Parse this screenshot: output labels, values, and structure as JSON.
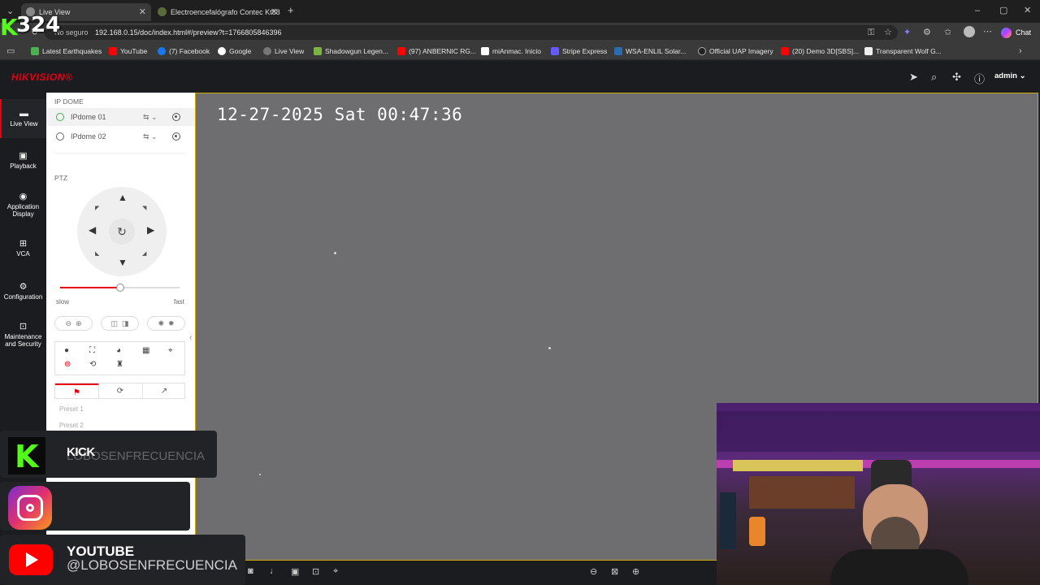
{
  "browser": {
    "tabs": [
      {
        "title": "Live View",
        "active": true
      },
      {
        "title": "Electroencefalógrafo Contec Kt88",
        "active": false
      }
    ],
    "security_label": "No seguro",
    "url": "192.168.0.15/doc/index.html#/preview?t=1766805846396",
    "chat_label": "Chat",
    "bookmarks": [
      "Latest Earthquakes",
      "YouTube",
      "(7) Facebook",
      "Google",
      "Live View",
      "Shadowgun Legen...",
      "(97) ANBERNIC RG...",
      "miAnmac. Inicio",
      "Stripe Express",
      "WSA-ENLIL Solar...",
      "Official UAP Imagery",
      "(20) Demo 3D[SBS]...",
      "Transparent Wolf G..."
    ]
  },
  "app": {
    "brand": "HIKVISION®",
    "user": "admin",
    "nav": [
      {
        "label": "Live View",
        "icon": "live-view-icon",
        "active": true
      },
      {
        "label": "Playback",
        "icon": "playback-icon",
        "active": false
      },
      {
        "label": "Application Display",
        "icon": "application-icon",
        "active": false
      },
      {
        "label": "VCA",
        "icon": "vca-icon",
        "active": false
      },
      {
        "label": "Configuration",
        "icon": "gear-icon",
        "active": false
      },
      {
        "label": "Maintenance and Security",
        "icon": "maintenance-icon",
        "active": false
      }
    ],
    "panel": {
      "group_title": "IP DOME",
      "cameras": [
        {
          "name": "IPdome 01",
          "selected": true
        },
        {
          "name": "IPdome 02",
          "selected": false
        }
      ],
      "ptz_title": "PTZ",
      "speed": {
        "min_label": "slow",
        "max_label": "fast",
        "value": 0.5
      },
      "presets": [
        "Preset 1",
        "Preset 2"
      ]
    },
    "video": {
      "osd_timestamp": "12-27-2025 Sat 00:47:36"
    }
  },
  "overlays": {
    "kick_count": "324",
    "kick_title": "KICK",
    "kick_handle": "LOBOSENFRECUENCIA",
    "youtube_title": "YOUTUBE",
    "youtube_handle": "@LOBOSENFRECUENCIA",
    "colors": {
      "kick": "#53fc18",
      "youtube": "#ff0000",
      "hikvision": "#e60012"
    }
  }
}
